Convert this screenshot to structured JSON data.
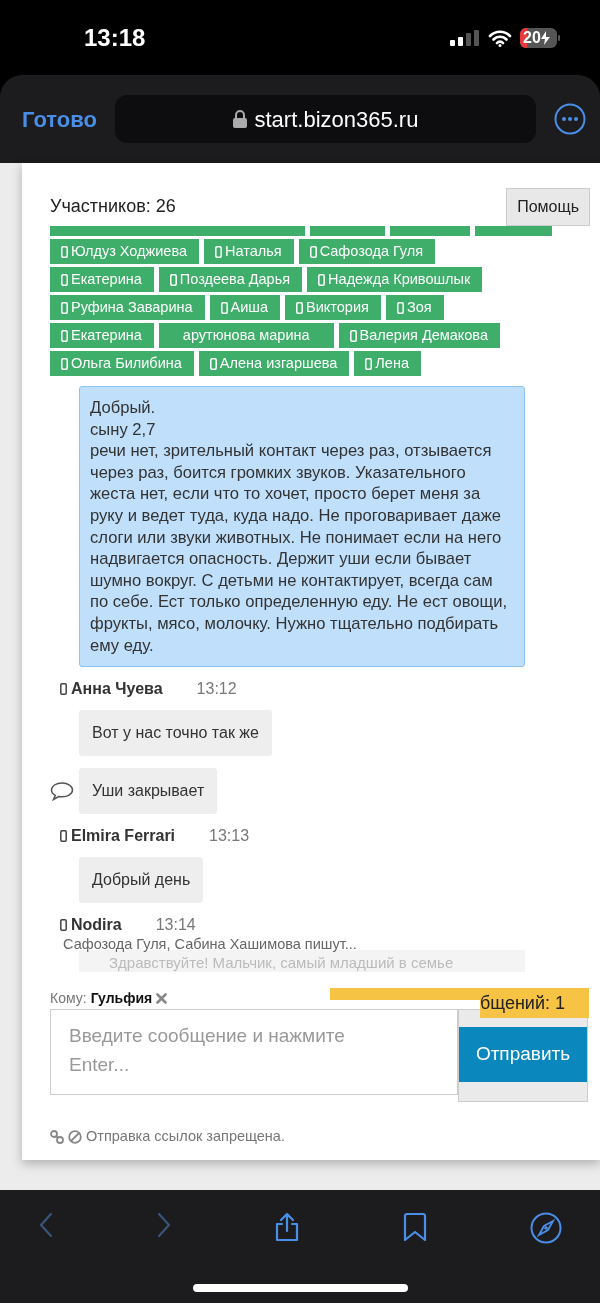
{
  "status_bar": {
    "time": "13:18",
    "battery": {
      "label": "20",
      "level": 0.2,
      "charging": true
    }
  },
  "browser": {
    "done_button": "Готово",
    "url": "start.bizon365.ru",
    "secure": true,
    "back_enabled": false,
    "forward_enabled": false
  },
  "chat": {
    "participants_label": "Участников: 26",
    "help_button": "Помощь",
    "participant_rows": [
      [
        {
          "name": "Юлдуз Ходжиева",
          "mobile": true
        },
        {
          "name": "Наталья",
          "mobile": true
        },
        {
          "name": "Сафозода Гуля",
          "mobile": true
        }
      ],
      [
        {
          "name": "Екатерина",
          "mobile": true
        },
        {
          "name": "Поздеева Дарья",
          "mobile": true
        },
        {
          "name": "Надежда Кривошлык",
          "mobile": true
        }
      ],
      [
        {
          "name": "Руфина Заварина",
          "mobile": true
        },
        {
          "name": "Аиша",
          "mobile": true
        },
        {
          "name": "Виктория",
          "mobile": true
        },
        {
          "name": "Зоя",
          "mobile": true
        }
      ],
      [
        {
          "name": "Екатерина",
          "mobile": true
        },
        {
          "name": "арутюнова марина",
          "mobile": false
        },
        {
          "name": "Валерия Демакова",
          "mobile": true
        }
      ],
      [
        {
          "name": "Ольга Билибина",
          "mobile": true
        },
        {
          "name": "Алена изгаршева",
          "mobile": true
        },
        {
          "name": "Лена",
          "mobile": true
        }
      ]
    ],
    "messages": [
      {
        "kind": "bubble",
        "highlighted": true,
        "comment_icon": false,
        "text": "Добрый.\nсыну 2,7\nречи нет, зрительный контакт через раз, отзывается через раз, боится громких звуков. Указательного жеста нет, если что то хочет, просто берет меня за руку и ведет туда, куда надо. Не проговаривает даже слоги или звуки животных. Не понимает если на него надвигается опасность. Держит уши если бывает шумно вокруг. С детьми не контактирует, всегда сам по себе. Ест только определенную еду. Не ест овощи, фрукты, мясо, молочку. Нужно тщательно подбирать ему еду."
      },
      {
        "kind": "header",
        "author": "Анна Чуева",
        "time": "13:12",
        "mobile": true
      },
      {
        "kind": "bubble",
        "highlighted": false,
        "comment_icon": false,
        "text": "Вот у нас точно так же"
      },
      {
        "kind": "bubble",
        "highlighted": false,
        "comment_icon": true,
        "text": "Уши закрывает"
      },
      {
        "kind": "header",
        "author": "Elmira Ferrari",
        "time": "13:13",
        "mobile": true
      },
      {
        "kind": "bubble",
        "highlighted": false,
        "comment_icon": false,
        "text": "Добрый день"
      },
      {
        "kind": "header",
        "author": "Nodira",
        "time": "13:14",
        "mobile": true
      },
      {
        "kind": "faded",
        "text": "Здравствуйте! Мальчик, самый младший в семье"
      }
    ],
    "typing": "Сафозода Гуля, Сабина Хашимова пишут...",
    "recipient_label": "Кому:",
    "recipient": "Гульфия",
    "new_messages_notice": "бщений: 1",
    "input_placeholder": "Введите сообщение и нажмите Enter...",
    "send_button": "Отправить",
    "link_notice": "Отправка ссылок запрещена."
  }
}
